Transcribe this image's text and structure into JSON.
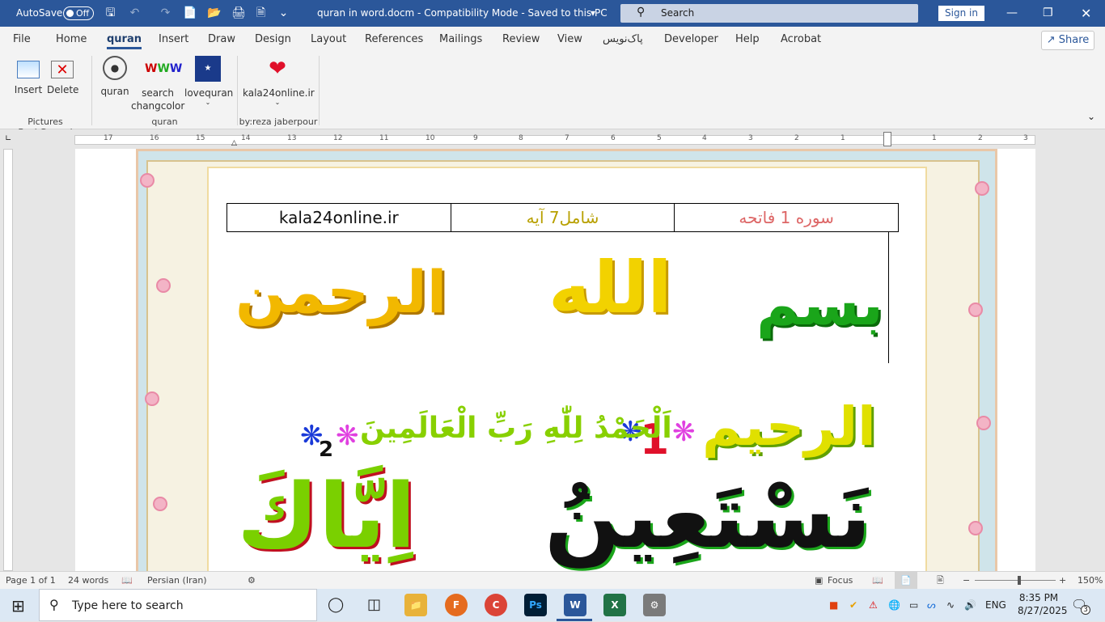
{
  "titlebar": {
    "autosave_label": "AutoSave",
    "autosave_state": "Off",
    "doc_title": "quran in word.docm  -  Compatibility Mode  -  Saved to this PC",
    "search_placeholder": "Search",
    "signin_label": "Sign in"
  },
  "menu": {
    "items": [
      "File",
      "Home",
      "quran",
      "Insert",
      "Draw",
      "Design",
      "Layout",
      "References",
      "Mailings",
      "Review",
      "View",
      "پاک‌نویس",
      "Developer",
      "Help",
      "Acrobat"
    ],
    "active": "quran",
    "share_label": "Share"
  },
  "ribbon": {
    "groups": [
      {
        "name": "Pictures BackGround",
        "buttons": [
          "Insert",
          "Delete"
        ]
      },
      {
        "name": "quran",
        "buttons": [
          "quran",
          "search changcolor",
          "lovequran"
        ]
      },
      {
        "name": "by:reza jaberpour",
        "buttons": [
          "kala24online.ir"
        ]
      }
    ]
  },
  "ruler": {
    "numbers": [
      "17",
      "16",
      "15",
      "14",
      "13",
      "12",
      "11",
      "10",
      "9",
      "8",
      "7",
      "6",
      "5",
      "4",
      "3",
      "2",
      "1",
      "1",
      "2",
      "3"
    ]
  },
  "document": {
    "table": {
      "cell1": "kala24online.ir",
      "cell2": "شامل7 آیه",
      "cell3": "سوره  1   فاتحه"
    },
    "line1": {
      "w1": "بسم",
      "w2": "الله",
      "w3": "الرحمن"
    },
    "line2": {
      "w1": "الرحیم",
      "n1": "1",
      "w2": "اَلْحَمْدُ لِلّٰهِ رَبِّ الْعَالَمِينَ",
      "n2": "2"
    },
    "line3": {
      "w1": "نَسْتَعِينُ",
      "w2": "اِيَّاكَ"
    }
  },
  "status": {
    "page": "Page 1 of 1",
    "words": "24 words",
    "language": "Persian (Iran)",
    "focus": "Focus",
    "zoom": "150%"
  },
  "taskbar": {
    "search_placeholder": "Type here to search",
    "lang": "ENG",
    "time": "8:35 PM",
    "date": "8/27/2025",
    "notifications": "3"
  }
}
